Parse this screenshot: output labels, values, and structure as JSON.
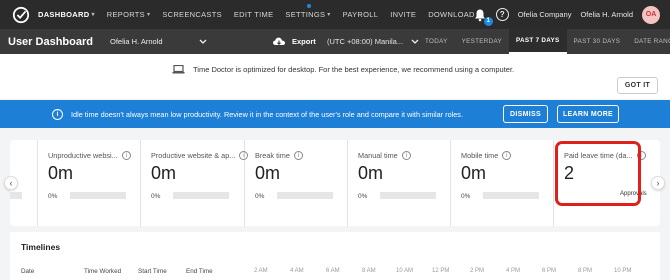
{
  "nav": {
    "items": [
      {
        "label": "DASHBOARD",
        "dropdown": true,
        "active": true
      },
      {
        "label": "REPORTS",
        "dropdown": true,
        "active": false
      },
      {
        "label": "SCREENCASTS",
        "dropdown": false,
        "active": false
      },
      {
        "label": "EDIT TIME",
        "dropdown": false,
        "active": false
      },
      {
        "label": "SETTINGS",
        "dropdown": true,
        "active": false
      },
      {
        "label": "PAYROLL",
        "dropdown": false,
        "active": false
      },
      {
        "label": "INVITE",
        "dropdown": false,
        "active": false
      },
      {
        "label": "DOWNLOAD",
        "dropdown": false,
        "active": false
      }
    ],
    "notification_count": "1",
    "company": "Ofelia Company",
    "user_name": "Ofelia H. Arnold",
    "avatar_initials": "OA"
  },
  "subbar": {
    "title": "User Dashboard",
    "selected_user": "Ofelia H. Arnold",
    "export_label": "Export",
    "timezone": "(UTC +08:00) Manila...",
    "ranges": [
      "TODAY",
      "YESTERDAY",
      "PAST 7 DAYS",
      "PAST 30 DAYS",
      "DATE RANGE"
    ],
    "active_range": "PAST 7 DAYS"
  },
  "notice": {
    "text": "Time Doctor is optimized for desktop. For the best experience, we recommend using a computer.",
    "button": "GOT IT"
  },
  "banner": {
    "text": "Idle time doesn't always mean low productivity. Review it in the context of the user's role and compare it with similar roles.",
    "dismiss": "DISMISS",
    "learn_more": "LEARN MORE"
  },
  "cards": [
    {
      "title": "Unproductive websi...",
      "value": "0m",
      "pct": "0%"
    },
    {
      "title": "Productive website & ap...",
      "value": "0m",
      "pct": "0%"
    },
    {
      "title": "Break time",
      "value": "0m",
      "pct": "0%"
    },
    {
      "title": "Manual time",
      "value": "0m",
      "pct": "0%"
    },
    {
      "title": "Mobile time",
      "value": "0m",
      "pct": "0%"
    },
    {
      "title": "Paid leave time (da...",
      "value": "2",
      "sub": "Approvals"
    }
  ],
  "first_card_pct": "0%",
  "timelines": {
    "title": "Timelines",
    "headers": [
      "Date",
      "Time Worked",
      "Start Time",
      "End Time"
    ],
    "hours": [
      "2 AM",
      "4 AM",
      "6 AM",
      "8 AM",
      "10 AM",
      "12 PM",
      "2 PM",
      "4 PM",
      "6 PM",
      "8 PM",
      "10 PM"
    ]
  },
  "colors": {
    "topbar": "#2b2b2b",
    "subbar": "#3a3a3a",
    "banner": "#1e7fd6",
    "highlight": "#e0201b"
  }
}
